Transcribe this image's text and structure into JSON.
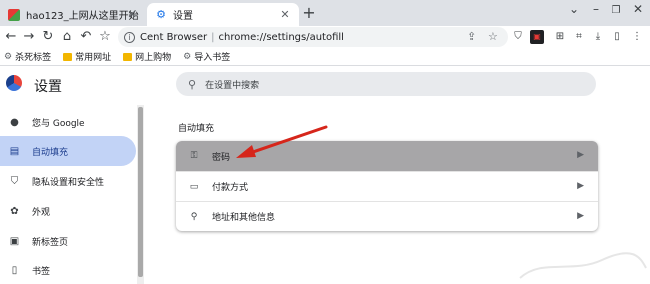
{
  "tabs": [
    {
      "title": "hao123_上网从这里开始",
      "active": false
    },
    {
      "title": "设置",
      "active": true
    }
  ],
  "toolbar": {
    "site": "Cent Browser",
    "url": "chrome://settings/autofill"
  },
  "bookmarks": [
    "杀死标签",
    "常用网址",
    "网上购物",
    "导入书签"
  ],
  "settings": {
    "title": "设置",
    "search_placeholder": "在设置中搜索"
  },
  "sidebar": {
    "items": [
      {
        "label": "您与 Google",
        "icon": "person-icon",
        "active": false
      },
      {
        "label": "自动填充",
        "icon": "clipboard-icon",
        "active": true
      },
      {
        "label": "隐私设置和安全性",
        "icon": "shield-icon",
        "active": false
      },
      {
        "label": "外观",
        "icon": "palette-icon",
        "active": false
      },
      {
        "label": "新标签页",
        "icon": "newtab-icon",
        "active": false
      },
      {
        "label": "书签",
        "icon": "bookmark-icon",
        "active": false
      }
    ]
  },
  "autofill": {
    "section_title": "自动填充",
    "rows": [
      {
        "label": "密码",
        "icon": "key-icon"
      },
      {
        "label": "付款方式",
        "icon": "credit-card-icon"
      },
      {
        "label": "地址和其他信息",
        "icon": "location-pin-icon"
      }
    ]
  },
  "colors": {
    "active_sidebar_bg": "#c2d3f6",
    "highlight_row_bg": "#a7a6a8",
    "arrow": "#d6261b"
  }
}
